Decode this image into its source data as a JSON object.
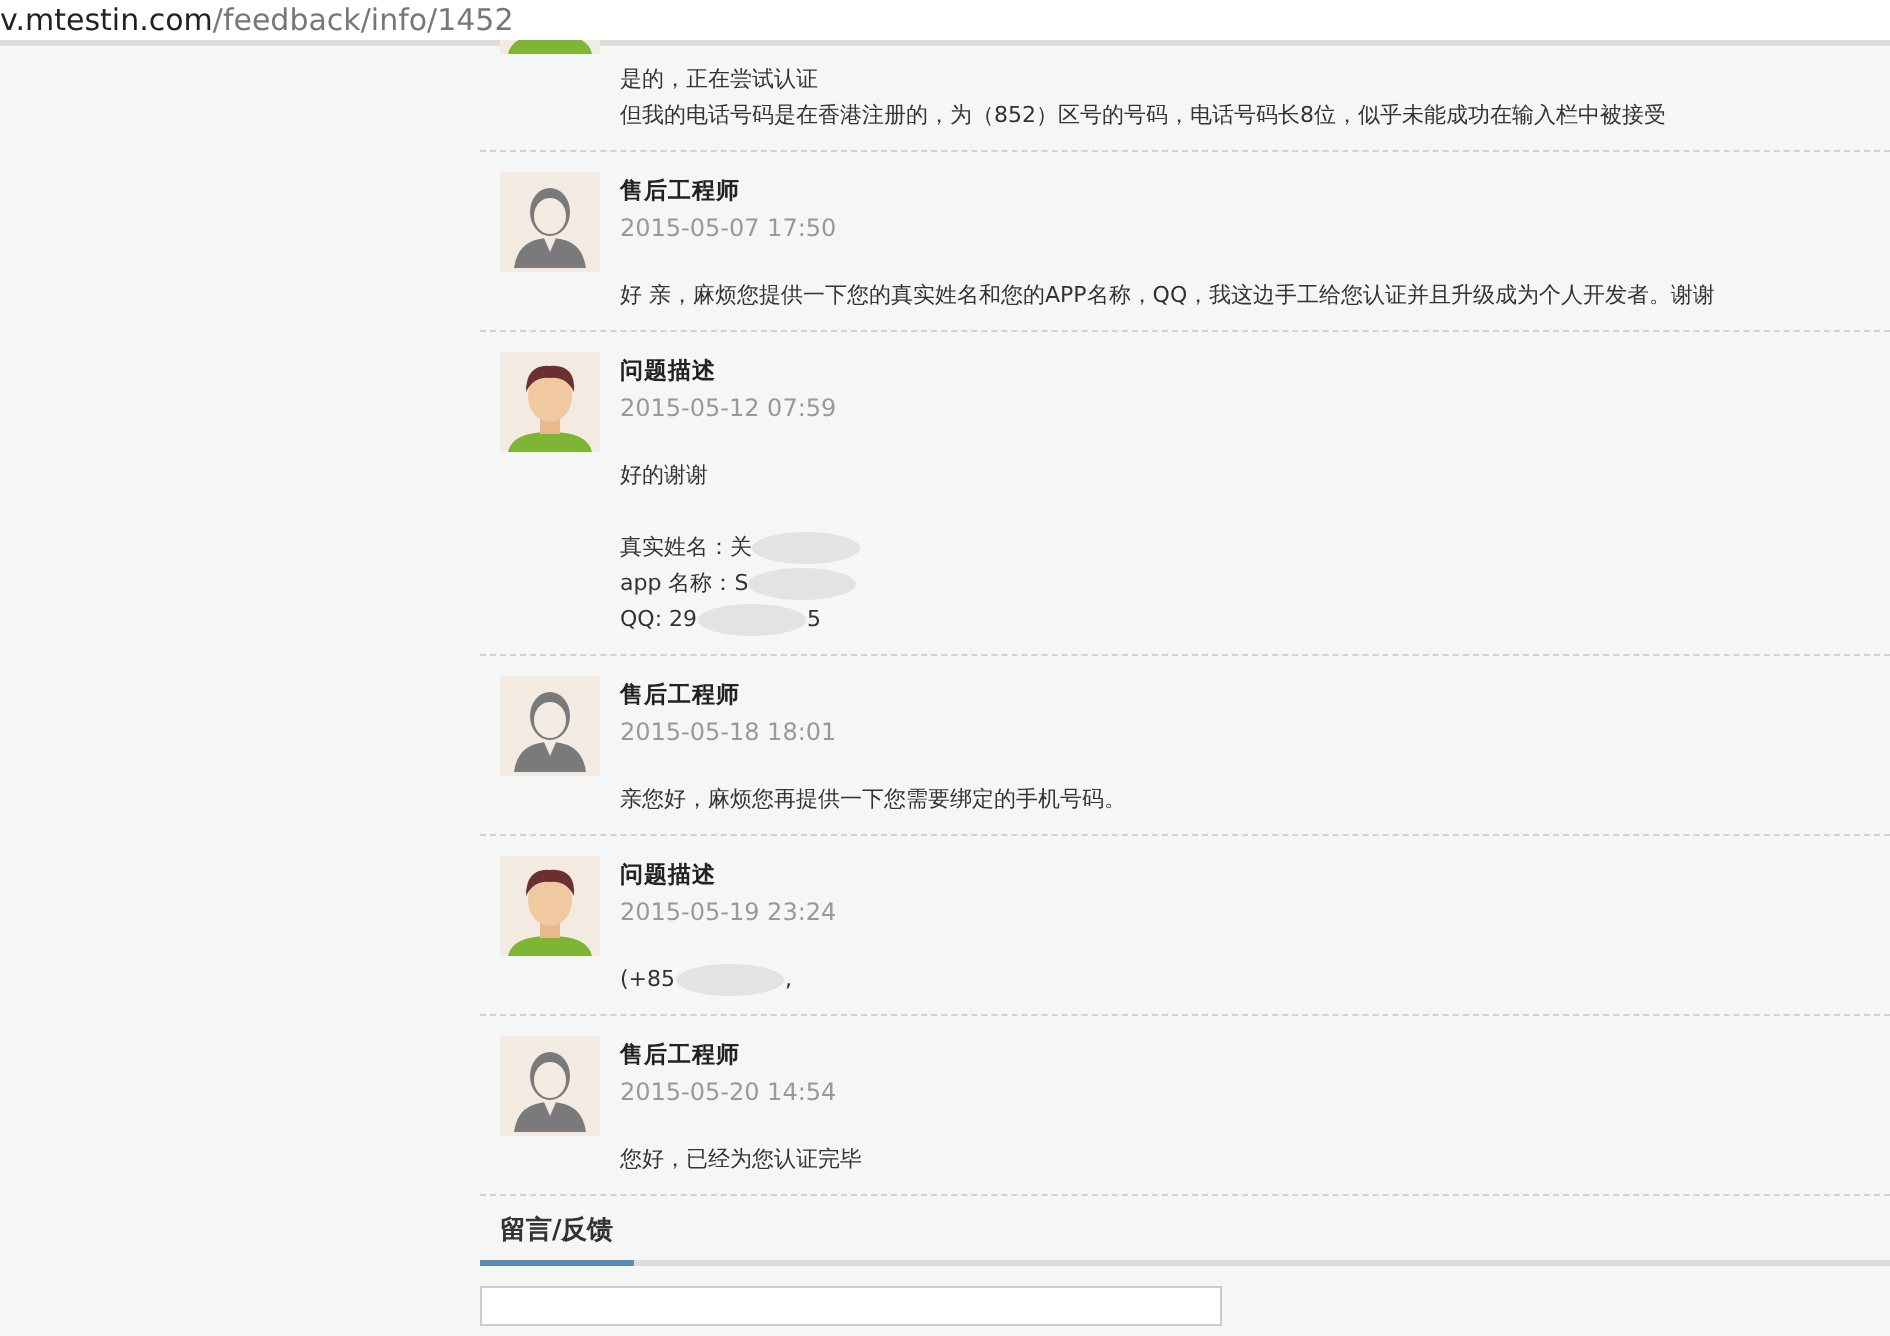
{
  "address_bar": {
    "host": "v.mtestin.com",
    "path": "/feedback/info/1452"
  },
  "messages": [
    {
      "kind": "user",
      "paragraphs": [
        [
          [
            {
              "kind": "text",
              "text": "是的，正在尝试认证"
            }
          ],
          [
            {
              "kind": "text",
              "text": "但我的电话号码是在香港注册的，为（852）区号的号码，电话号码长8位，似乎未能成功在输入栏中被接受"
            }
          ]
        ]
      ]
    },
    {
      "kind": "engineer",
      "author": "售后工程师",
      "date": "2015-05-07 17:50",
      "paragraphs": [
        [
          [
            {
              "kind": "text",
              "text": "好 亲，麻烦您提供一下您的真实姓名和您的APP名称，QQ，我这边手工给您认证并且升级成为个人开发者。谢谢"
            }
          ]
        ]
      ]
    },
    {
      "kind": "user",
      "author": "问题描述",
      "date": "2015-05-12 07:59",
      "paragraphs": [
        [
          [
            {
              "kind": "text",
              "text": "好的谢谢"
            }
          ]
        ],
        [
          [
            {
              "kind": "text",
              "text": "真实姓名：关"
            },
            {
              "kind": "blur"
            }
          ],
          [
            {
              "kind": "text",
              "text": "app 名称：S"
            },
            {
              "kind": "blur"
            }
          ],
          [
            {
              "kind": "text",
              "text": "QQ: 29"
            },
            {
              "kind": "blur"
            },
            {
              "kind": "text",
              "text": "5"
            }
          ]
        ]
      ]
    },
    {
      "kind": "engineer",
      "author": "售后工程师",
      "date": "2015-05-18 18:01",
      "paragraphs": [
        [
          [
            {
              "kind": "text",
              "text": "亲您好，麻烦您再提供一下您需要绑定的手机号码。"
            }
          ]
        ]
      ]
    },
    {
      "kind": "user",
      "author": "问题描述",
      "date": "2015-05-19 23:24",
      "paragraphs": [
        [
          [
            {
              "kind": "text",
              "text": "(+85"
            },
            {
              "kind": "blur"
            },
            {
              "kind": "text",
              "text": ","
            }
          ]
        ]
      ]
    },
    {
      "kind": "engineer",
      "author": "售后工程师",
      "date": "2015-05-20 14:54",
      "paragraphs": [
        [
          [
            {
              "kind": "text",
              "text": "您好，已经为您认证完毕"
            }
          ]
        ]
      ]
    }
  ],
  "tabs": [
    {
      "label": "留言/反馈",
      "selected": true
    }
  ]
}
